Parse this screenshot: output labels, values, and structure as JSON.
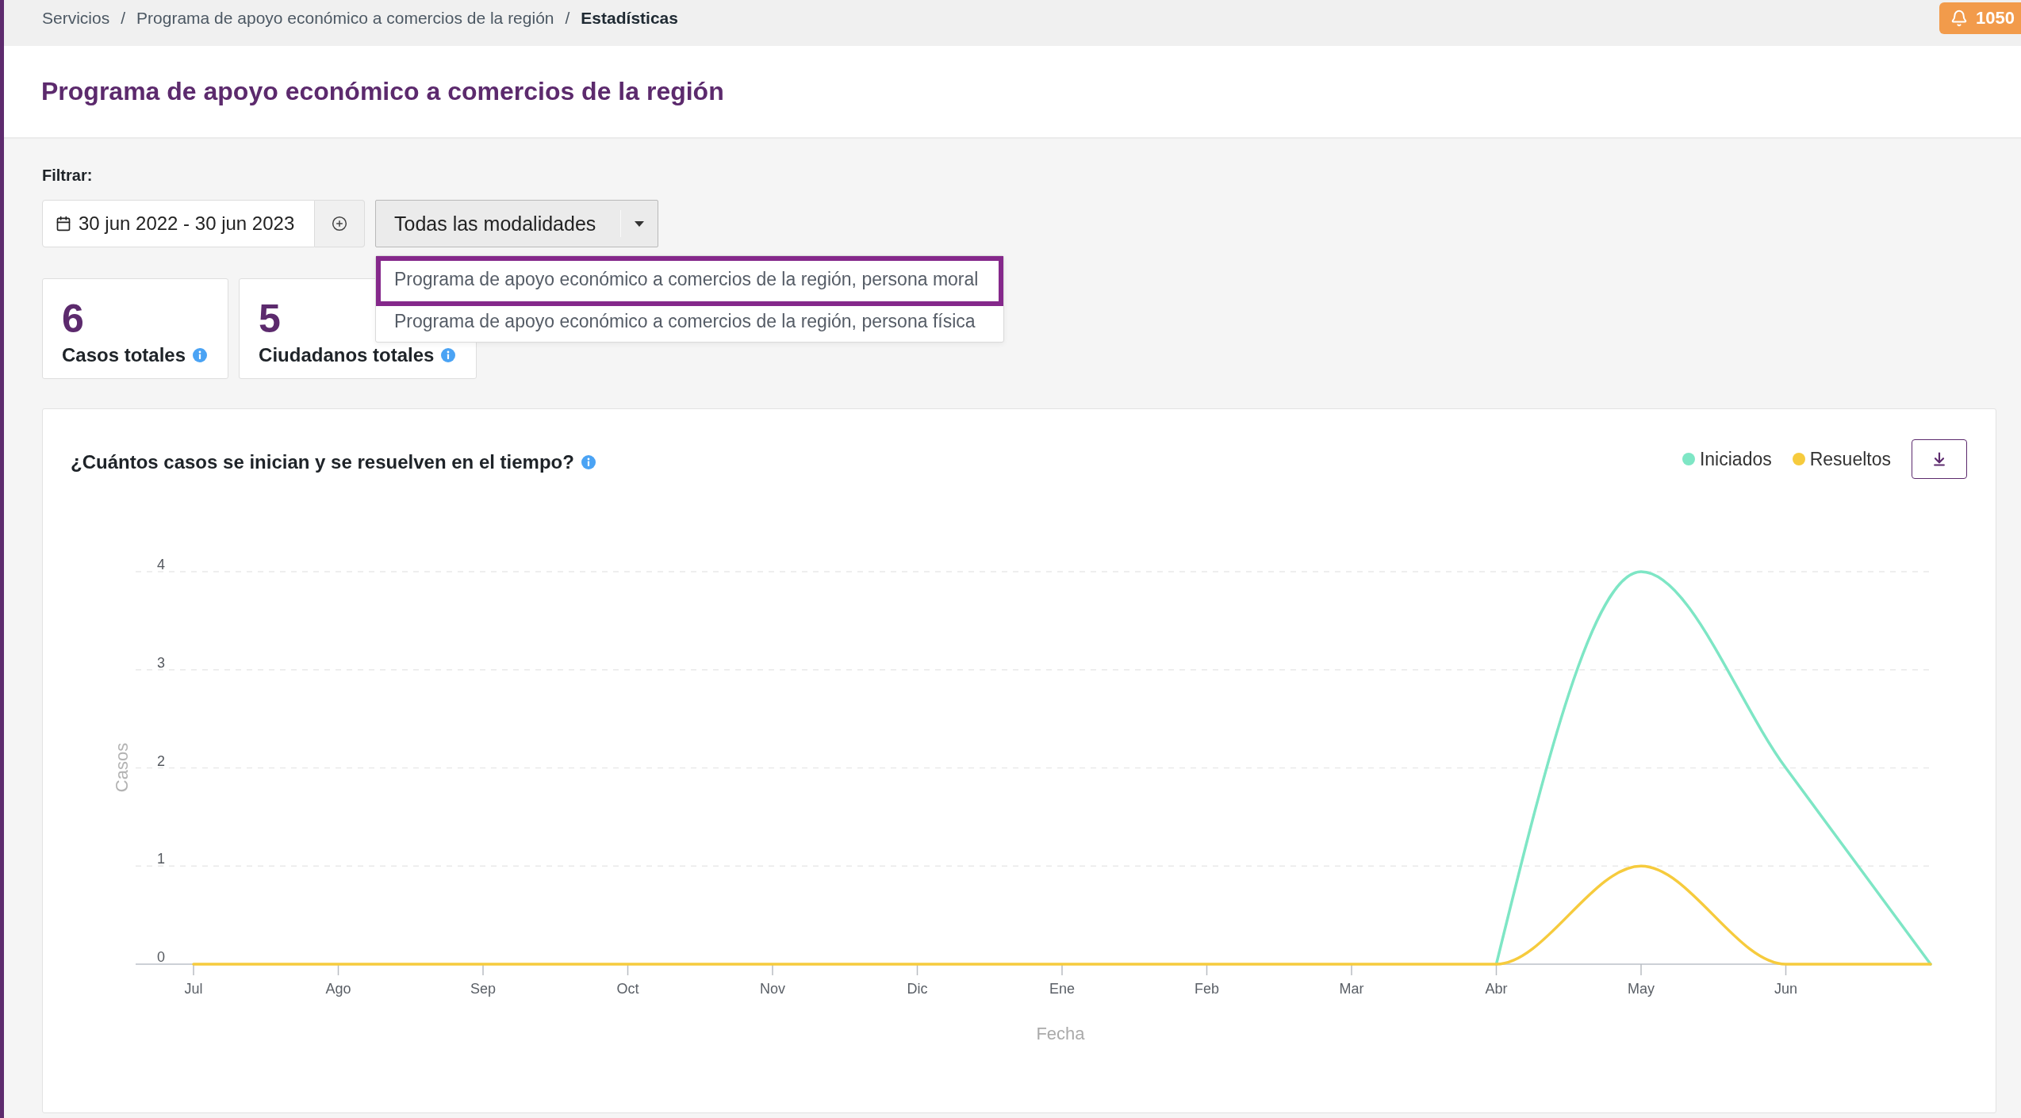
{
  "breadcrumb": {
    "separator": "/",
    "items": [
      {
        "label": "Servicios",
        "current": false
      },
      {
        "label": "Programa de apoyo económico a comercios de la región",
        "current": false
      },
      {
        "label": "Estadísticas",
        "current": true
      }
    ]
  },
  "notifications": {
    "count": "1050"
  },
  "page_title": "Programa de apoyo económico a comercios de la región",
  "filters": {
    "label": "Filtrar:",
    "date_range": {
      "value": "30 jun 2022 - 30 jun 2023"
    },
    "modality": {
      "value": "Todas las modalidades",
      "expanded": true,
      "options": [
        {
          "label": "Programa de apoyo económico a comercios de la región, persona moral",
          "focused": true
        },
        {
          "label": "Programa de apoyo económico a comercios de la región, persona física",
          "focused": false
        }
      ]
    }
  },
  "stats": [
    {
      "value": "6",
      "label": "Casos totales"
    },
    {
      "value": "5",
      "label": "Ciudadanos totales"
    }
  ],
  "chart": {
    "title": "¿Cuántos casos se inician y se resuelven en el tiempo?",
    "chart_data": {
      "type": "line",
      "xlabel": "Fecha",
      "ylabel": "Casos",
      "grid": true,
      "categories": [
        "Jul",
        "Ago",
        "Sep",
        "Oct",
        "Nov",
        "Dic",
        "Ene",
        "Feb",
        "Mar",
        "Abr",
        "May",
        "Jun",
        null
      ],
      "ylim": [
        0,
        4
      ],
      "yticks": [
        0,
        1,
        2,
        3,
        4
      ],
      "series": [
        {
          "name": "Iniciados",
          "color": "#7ee6c5",
          "values": [
            null,
            null,
            null,
            null,
            null,
            null,
            null,
            null,
            null,
            0,
            4,
            2,
            0
          ]
        },
        {
          "name": "Resueltos",
          "color": "#f6cb3d",
          "values": [
            0,
            0,
            0,
            0,
            0,
            0,
            0,
            0,
            0,
            0,
            1,
            0,
            0
          ]
        }
      ]
    }
  }
}
